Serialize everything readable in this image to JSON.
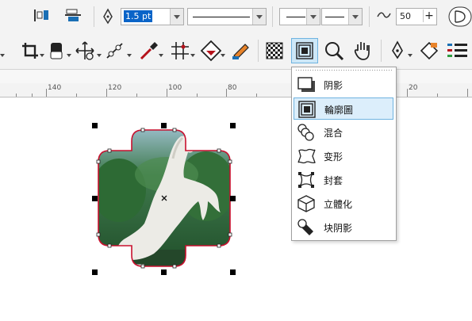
{
  "property_bar": {
    "outline_width": "1.5 pt",
    "smoothing_value": "50",
    "smoothing_plus": "+"
  },
  "ruler": {
    "ticks": [
      "140",
      "120",
      "100",
      "80",
      "20"
    ]
  },
  "effects_menu": {
    "items": [
      {
        "label": "阴影",
        "icon": "drop-shadow-icon"
      },
      {
        "label": "輪廓圖",
        "icon": "contour-icon"
      },
      {
        "label": "混合",
        "icon": "blend-icon"
      },
      {
        "label": "变形",
        "icon": "distort-icon"
      },
      {
        "label": "封套",
        "icon": "envelope-icon"
      },
      {
        "label": "立體化",
        "icon": "extrude-icon"
      },
      {
        "label": "块阴影",
        "icon": "block-shadow-icon"
      }
    ],
    "active_item": "輪廓圖"
  },
  "colors": {
    "toolbar_bg": "#f3f3f3",
    "active_highlight": "#dceefb",
    "active_border": "#6fb3e0",
    "outline_red": "#c8102e",
    "accent_blue": "#1a6fb5"
  }
}
